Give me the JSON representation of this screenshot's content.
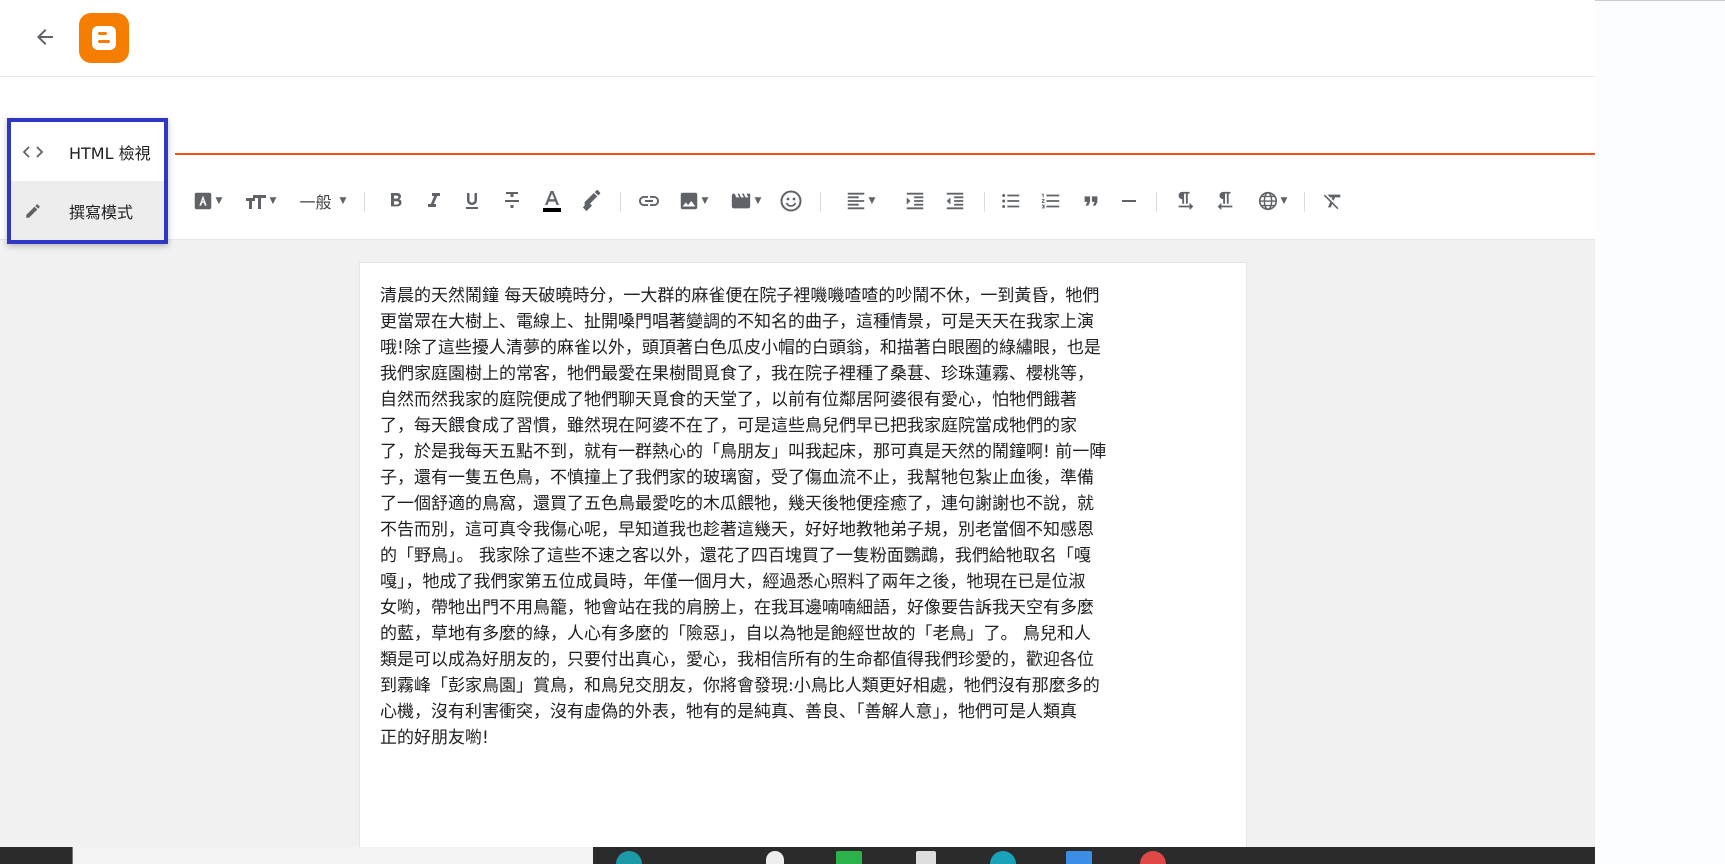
{
  "app": {
    "name": "Blogger",
    "accent": "#f57d00",
    "title_underline_color": "#f4511e"
  },
  "topbar": {
    "back_icon": "arrow-back-icon",
    "logo_icon": "blogger-logo-icon"
  },
  "post": {
    "title": ""
  },
  "mode_menu": {
    "border_color": "#2e38c4",
    "items": [
      {
        "icon": "code-icon",
        "label": "HTML 檢視"
      },
      {
        "icon": "pencil-icon",
        "label": "撰寫模式",
        "selected": true
      }
    ]
  },
  "toolbar": {
    "paragraph_style": "一般",
    "buttons": [
      "font-icon",
      "font-size-icon",
      "bold-icon",
      "italic-icon",
      "underline-icon",
      "strikethrough-icon",
      "text-color-icon",
      "highlight-icon",
      "link-icon",
      "image-icon",
      "video-icon",
      "emoji-icon",
      "align-icon",
      "indent-icon",
      "outdent-icon",
      "bulleted-list-icon",
      "numbered-list-icon",
      "quote-icon",
      "horizontal-rule-icon",
      "ltr-icon",
      "rtl-icon",
      "translate-icon",
      "clear-format-icon"
    ]
  },
  "content": {
    "lines": [
      "清晨的天然鬧鐘 每天破曉時分，一大群的麻雀便在院子裡嘰嘰喳喳的吵鬧不休，一到黃昏，牠們",
      "更當眾在大樹上、電線上、扯開嗓門唱著變調的不知名的曲子，這種情景，可是天天在我家上演",
      "哦!除了這些擾人清夢的麻雀以外，頭頂著白色瓜皮小帽的白頭翁，和描著白眼圈的綠繡眼，也是",
      "我們家庭園樹上的常客，牠們最愛在果樹間覓食了，我在院子裡種了桑葚、珍珠蓮霧、櫻桃等，",
      "自然而然我家的庭院便成了牠們聊天覓食的天堂了，以前有位鄰居阿婆很有愛心，怕牠們餓著",
      "了，每天餵食成了習慣，雖然現在阿婆不在了，可是這些鳥兒們早已把我家庭院當成牠們的家",
      "了，於是我每天五點不到，就有一群熱心的「鳥朋友」叫我起床，那可真是天然的鬧鐘啊! 前一陣",
      "子，還有一隻五色鳥，不慎撞上了我們家的玻璃窗，受了傷血流不止，我幫牠包紮止血後，準備",
      "了一個舒適的鳥窩，還買了五色鳥最愛吃的木瓜餵牠，幾天後牠便痊癒了，連句謝謝也不說，就",
      "不告而別，這可真令我傷心呢，早知道我也趁著這幾天，好好地教牠弟子規，別老當個不知感恩",
      "的「野鳥」。 我家除了這些不速之客以外，還花了四百塊買了一隻粉面鸚鵡，我們給牠取名「嘎",
      "嘎」，牠成了我們家第五位成員時，年僅一個月大，經過悉心照料了兩年之後，牠現在已是位淑",
      "女喲，帶牠出門不用鳥籠，牠會站在我的肩膀上，在我耳邊喃喃細語，好像要告訴我天空有多麼",
      "的藍，草地有多麼的綠，人心有多麼的「險惡」，自以為牠是飽經世故的「老鳥」了。 鳥兒和人",
      "類是可以成為好朋友的，只要付出真心，愛心，我相信所有的生命都值得我們珍愛的，歡迎各位",
      "到霧峰「彭家鳥園」賞鳥，和鳥兒交朋友，你將會發現:小鳥比人類更好相處，牠們沒有那麼多的",
      "心機，沒有利害衝突，沒有虛偽的外表，牠有的是純真、善良、「善解人意」，牠們可是人類真",
      "正的好朋友喲!"
    ]
  }
}
